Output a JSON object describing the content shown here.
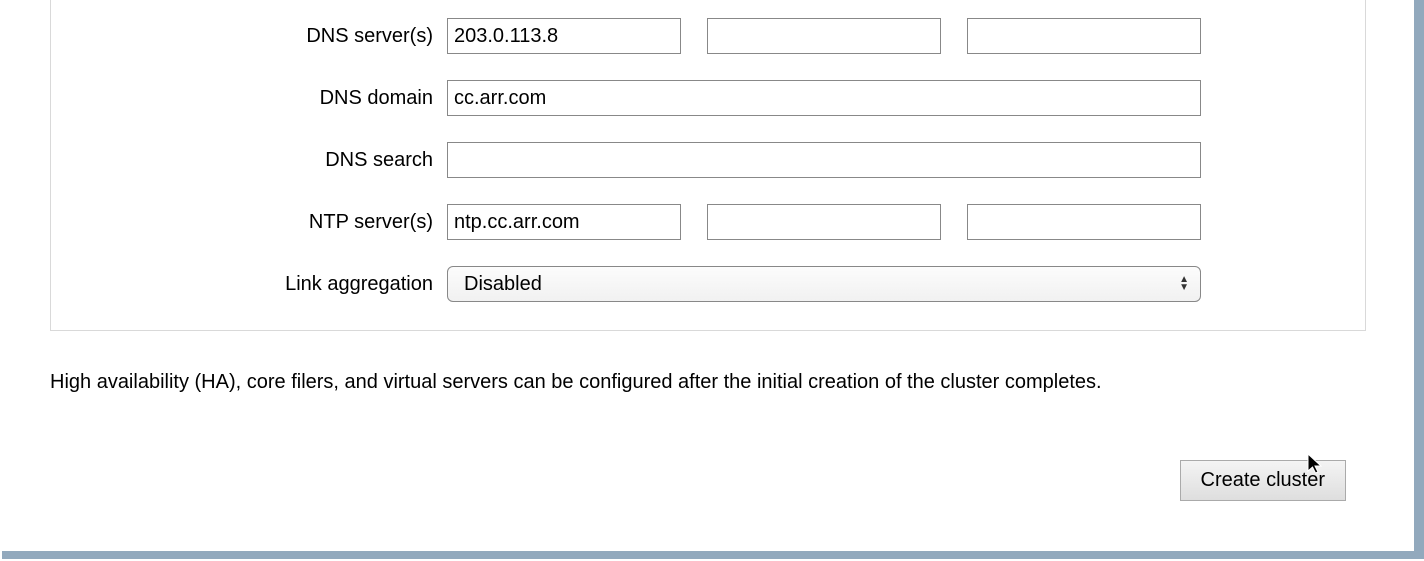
{
  "form": {
    "dns_servers": {
      "label": "DNS server(s)",
      "values": [
        "203.0.113.8",
        "",
        ""
      ]
    },
    "dns_domain": {
      "label": "DNS domain",
      "value": "cc.arr.com"
    },
    "dns_search": {
      "label": "DNS search",
      "value": ""
    },
    "ntp_servers": {
      "label": "NTP server(s)",
      "values": [
        "ntp.cc.arr.com",
        "",
        ""
      ]
    },
    "link_aggregation": {
      "label": "Link aggregation",
      "selected": "Disabled"
    }
  },
  "info_text": "High availability (HA), core filers, and virtual servers can be configured after the initial creation of the cluster completes.",
  "actions": {
    "create_cluster": "Create cluster"
  }
}
